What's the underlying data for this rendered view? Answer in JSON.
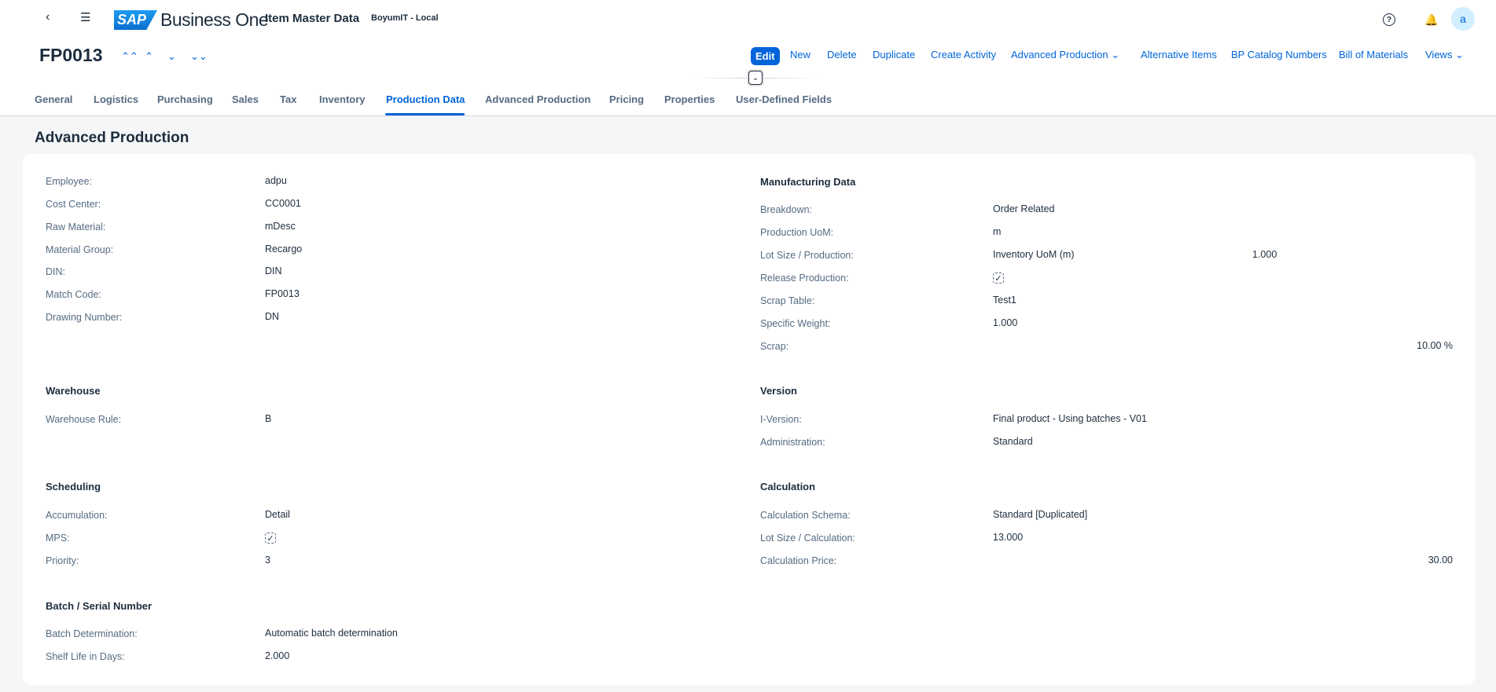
{
  "header": {
    "logo_text": "SAP",
    "product": "Business One",
    "title": "Item Master Data",
    "system": "BoyumIT - Local",
    "avatar": "a"
  },
  "object": {
    "id": "FP0013"
  },
  "toolbar": {
    "edit": "Edit",
    "new": "New",
    "delete": "Delete",
    "duplicate": "Duplicate",
    "create_activity": "Create Activity",
    "advanced_production": "Advanced Production",
    "alternative_items": "Alternative Items",
    "bp_catalog": "BP Catalog Numbers",
    "bom": "Bill of Materials",
    "views": "Views"
  },
  "tabs": [
    "General",
    "Logistics",
    "Purchasing",
    "Sales",
    "Tax",
    "Inventory",
    "Production Data",
    "Advanced Production",
    "Pricing",
    "Properties",
    "User-Defined Fields"
  ],
  "page_title": "Advanced Production",
  "left": {
    "general": [
      [
        "Employee:",
        "adpu"
      ],
      [
        "Cost Center:",
        "CC0001"
      ],
      [
        "Raw Material:",
        "mDesc"
      ],
      [
        "Material Group:",
        "Recargo"
      ],
      [
        "DIN:",
        "DIN"
      ],
      [
        "Match Code:",
        "FP0013"
      ],
      [
        "Drawing Number:",
        "DN"
      ]
    ],
    "warehouse": {
      "title": "Warehouse",
      "rows": [
        [
          "Warehouse Rule:",
          "B"
        ]
      ]
    },
    "scheduling": {
      "title": "Scheduling",
      "accumulation_label": "Accumulation:",
      "accumulation": "Detail",
      "mps_label": "MPS:",
      "mps_checked": true,
      "priority_label": "Priority:",
      "priority": "3"
    },
    "batch": {
      "title": "Batch / Serial Number",
      "rows": [
        [
          "Batch Determination:",
          "Automatic batch determination"
        ],
        [
          "Shelf Life in Days:",
          "2.000"
        ]
      ]
    }
  },
  "right": {
    "manufacturing": {
      "title": "Manufacturing Data",
      "breakdown_label": "Breakdown:",
      "breakdown": "Order Related",
      "uom_label": "Production UoM:",
      "uom": "m",
      "lot_label": "Lot Size / Production:",
      "lot_uom": "Inventory UoM (m)",
      "lot_value": "1.000",
      "release_label": "Release Production:",
      "release_checked": true,
      "scrap_table_label": "Scrap Table:",
      "scrap_table": "Test1",
      "weight_label": "Specific Weight:",
      "weight": "1.000",
      "scrap_label": "Scrap:",
      "scrap": "10.00 %"
    },
    "version": {
      "title": "Version",
      "rows": [
        [
          "I-Version:",
          "Final product - Using batches - V01"
        ],
        [
          "Administration:",
          "Standard"
        ]
      ]
    },
    "calculation": {
      "title": "Calculation",
      "schema_label": "Calculation Schema:",
      "schema": "Standard [Duplicated]",
      "lot_label": "Lot Size / Calculation:",
      "lot": "13.000",
      "price_label": "Calculation Price:",
      "price": "30.00"
    }
  }
}
